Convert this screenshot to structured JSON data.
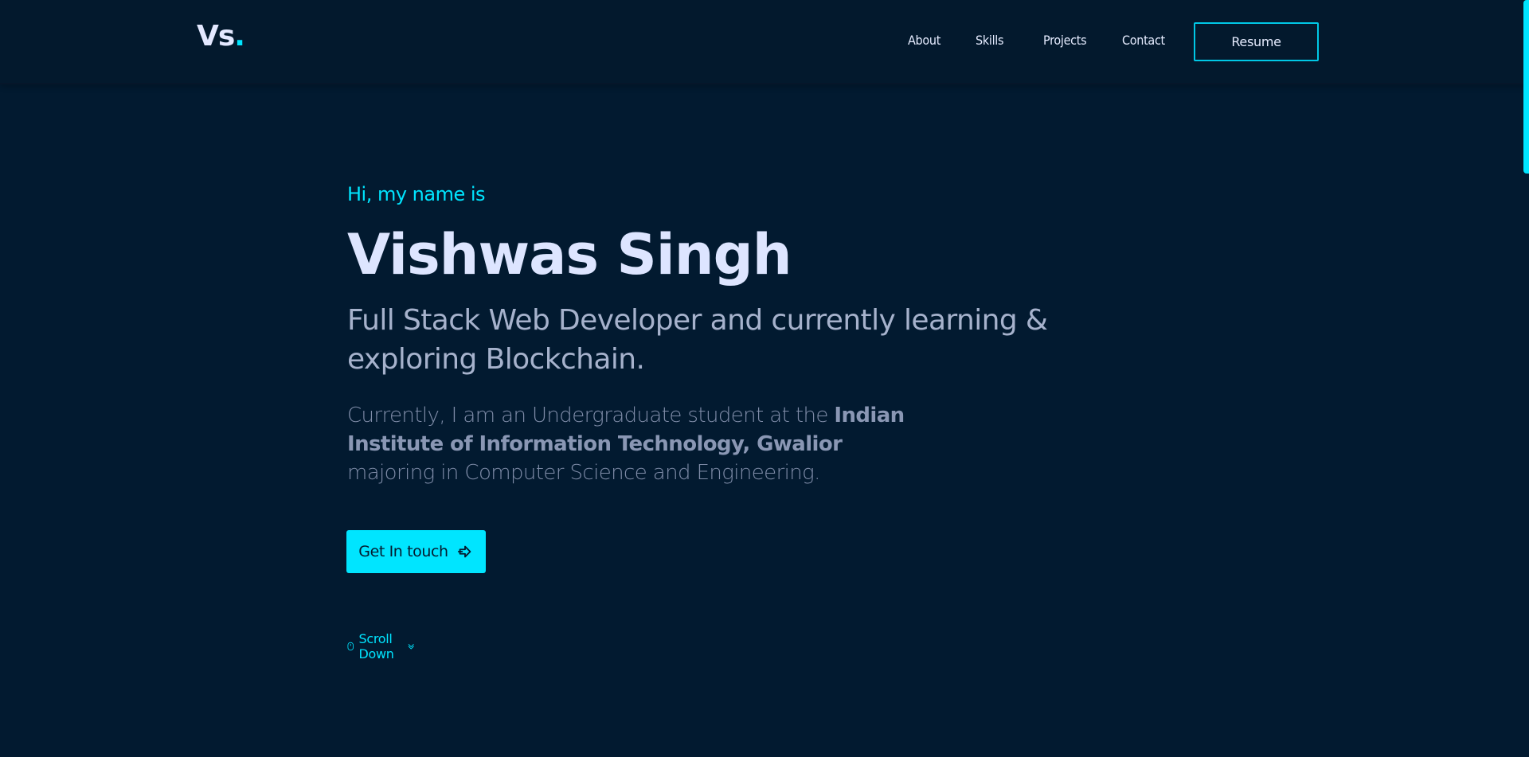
{
  "brand": {
    "logo_text": "Vs",
    "logo_dot": "."
  },
  "nav": {
    "items": [
      {
        "label": "About"
      },
      {
        "label": "Skills"
      },
      {
        "label": "Projects"
      },
      {
        "label": "Contact"
      }
    ],
    "resume_label": "Resume"
  },
  "hero": {
    "greeting": "Hi, my name is",
    "name": "Vishwas Singh",
    "tagline": "Full Stack Web Developer and currently learning & exploring Blockchain.",
    "bio_pre": "Currently, I am an Undergraduate student at the ",
    "bio_institute": "Indian Institute of Information Technology, Gwalior",
    "bio_post": " majoring in Computer Science and Engineering.",
    "cta_label": "Get In touch",
    "scroll_label": "Scroll Down"
  },
  "colors": {
    "accent": "#00e5ff",
    "background": "#021a30",
    "heading": "#dde5ff",
    "muted": "#7f8ca8"
  },
  "icons": {
    "cta": "arrow-right-icon",
    "scroll_mouse": "mouse-icon",
    "scroll_chevron": "double-chevron-down-icon"
  }
}
